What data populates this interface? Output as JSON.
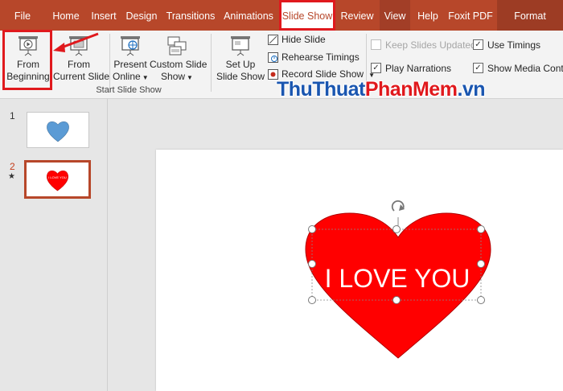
{
  "tabs": [
    {
      "label": "File"
    },
    {
      "label": "Home"
    },
    {
      "label": "Insert"
    },
    {
      "label": "Design"
    },
    {
      "label": "Transitions"
    },
    {
      "label": "Animations"
    },
    {
      "label": "Slide Show",
      "active": true
    },
    {
      "label": "Review"
    },
    {
      "label": "View"
    },
    {
      "label": "Help"
    },
    {
      "label": "Foxit PDF"
    },
    {
      "label": "Format"
    }
  ],
  "ribbon": {
    "from_beginning": {
      "line1": "From",
      "line2": "Beginning"
    },
    "from_current": {
      "line1": "From",
      "line2": "Current Slide"
    },
    "present_online": {
      "line1": "Present",
      "line2": "Online"
    },
    "custom_slide_show": {
      "line1": "Custom Slide",
      "line2": "Show"
    },
    "group_start": "Start Slide Show",
    "set_up": {
      "line1": "Set Up",
      "line2": "Slide Show"
    },
    "hide_slide": "Hide Slide",
    "rehearse_timings": "Rehearse Timings",
    "record_slide_show": "Record Slide Show",
    "keep_slides_updated": "Keep Slides Updated",
    "play_narrations": "Play Narrations",
    "use_timings": "Use Timings",
    "show_media_controls": "Show Media Contro"
  },
  "watermark": {
    "part1": "ThuThuat",
    "part2": "PhanMem",
    "part3": ".vn"
  },
  "slides": [
    {
      "number": "1",
      "selected": false
    },
    {
      "number": "2",
      "selected": true,
      "star": "★"
    }
  ],
  "thumb2_text": "I LOVE YOU",
  "slide_text": "I LOVE YOU",
  "colors": {
    "accent": "#b7472a",
    "highlight": "#e0191d",
    "heart": "#ff0000"
  }
}
